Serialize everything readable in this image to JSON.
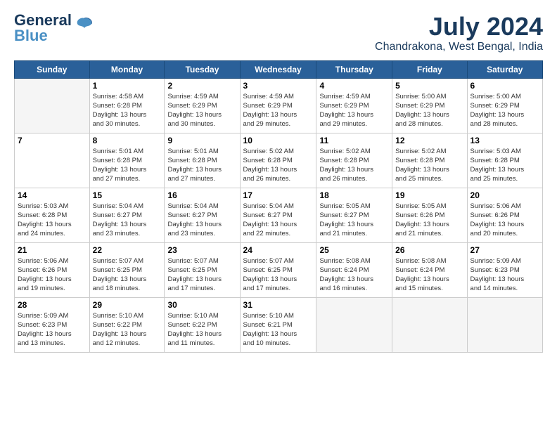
{
  "logo": {
    "line1": "General",
    "line2": "Blue"
  },
  "title": "July 2024",
  "subtitle": "Chandrakona, West Bengal, India",
  "days_of_week": [
    "Sunday",
    "Monday",
    "Tuesday",
    "Wednesday",
    "Thursday",
    "Friday",
    "Saturday"
  ],
  "weeks": [
    [
      {
        "day": "",
        "info": ""
      },
      {
        "day": "1",
        "info": "Sunrise: 4:58 AM\nSunset: 6:28 PM\nDaylight: 13 hours\nand 30 minutes."
      },
      {
        "day": "2",
        "info": "Sunrise: 4:59 AM\nSunset: 6:29 PM\nDaylight: 13 hours\nand 30 minutes."
      },
      {
        "day": "3",
        "info": "Sunrise: 4:59 AM\nSunset: 6:29 PM\nDaylight: 13 hours\nand 29 minutes."
      },
      {
        "day": "4",
        "info": "Sunrise: 4:59 AM\nSunset: 6:29 PM\nDaylight: 13 hours\nand 29 minutes."
      },
      {
        "day": "5",
        "info": "Sunrise: 5:00 AM\nSunset: 6:29 PM\nDaylight: 13 hours\nand 28 minutes."
      },
      {
        "day": "6",
        "info": "Sunrise: 5:00 AM\nSunset: 6:29 PM\nDaylight: 13 hours\nand 28 minutes."
      }
    ],
    [
      {
        "day": "7",
        "info": ""
      },
      {
        "day": "8",
        "info": "Sunrise: 5:01 AM\nSunset: 6:28 PM\nDaylight: 13 hours\nand 27 minutes."
      },
      {
        "day": "9",
        "info": "Sunrise: 5:01 AM\nSunset: 6:28 PM\nDaylight: 13 hours\nand 27 minutes."
      },
      {
        "day": "10",
        "info": "Sunrise: 5:02 AM\nSunset: 6:28 PM\nDaylight: 13 hours\nand 26 minutes."
      },
      {
        "day": "11",
        "info": "Sunrise: 5:02 AM\nSunset: 6:28 PM\nDaylight: 13 hours\nand 26 minutes."
      },
      {
        "day": "12",
        "info": "Sunrise: 5:02 AM\nSunset: 6:28 PM\nDaylight: 13 hours\nand 25 minutes."
      },
      {
        "day": "13",
        "info": "Sunrise: 5:03 AM\nSunset: 6:28 PM\nDaylight: 13 hours\nand 25 minutes."
      }
    ],
    [
      {
        "day": "14",
        "info": "Sunrise: 5:03 AM\nSunset: 6:28 PM\nDaylight: 13 hours\nand 24 minutes."
      },
      {
        "day": "15",
        "info": "Sunrise: 5:04 AM\nSunset: 6:27 PM\nDaylight: 13 hours\nand 23 minutes."
      },
      {
        "day": "16",
        "info": "Sunrise: 5:04 AM\nSunset: 6:27 PM\nDaylight: 13 hours\nand 23 minutes."
      },
      {
        "day": "17",
        "info": "Sunrise: 5:04 AM\nSunset: 6:27 PM\nDaylight: 13 hours\nand 22 minutes."
      },
      {
        "day": "18",
        "info": "Sunrise: 5:05 AM\nSunset: 6:27 PM\nDaylight: 13 hours\nand 21 minutes."
      },
      {
        "day": "19",
        "info": "Sunrise: 5:05 AM\nSunset: 6:26 PM\nDaylight: 13 hours\nand 21 minutes."
      },
      {
        "day": "20",
        "info": "Sunrise: 5:06 AM\nSunset: 6:26 PM\nDaylight: 13 hours\nand 20 minutes."
      }
    ],
    [
      {
        "day": "21",
        "info": "Sunrise: 5:06 AM\nSunset: 6:26 PM\nDaylight: 13 hours\nand 19 minutes."
      },
      {
        "day": "22",
        "info": "Sunrise: 5:07 AM\nSunset: 6:25 PM\nDaylight: 13 hours\nand 18 minutes."
      },
      {
        "day": "23",
        "info": "Sunrise: 5:07 AM\nSunset: 6:25 PM\nDaylight: 13 hours\nand 17 minutes."
      },
      {
        "day": "24",
        "info": "Sunrise: 5:07 AM\nSunset: 6:25 PM\nDaylight: 13 hours\nand 17 minutes."
      },
      {
        "day": "25",
        "info": "Sunrise: 5:08 AM\nSunset: 6:24 PM\nDaylight: 13 hours\nand 16 minutes."
      },
      {
        "day": "26",
        "info": "Sunrise: 5:08 AM\nSunset: 6:24 PM\nDaylight: 13 hours\nand 15 minutes."
      },
      {
        "day": "27",
        "info": "Sunrise: 5:09 AM\nSunset: 6:23 PM\nDaylight: 13 hours\nand 14 minutes."
      }
    ],
    [
      {
        "day": "28",
        "info": "Sunrise: 5:09 AM\nSunset: 6:23 PM\nDaylight: 13 hours\nand 13 minutes."
      },
      {
        "day": "29",
        "info": "Sunrise: 5:10 AM\nSunset: 6:22 PM\nDaylight: 13 hours\nand 12 minutes."
      },
      {
        "day": "30",
        "info": "Sunrise: 5:10 AM\nSunset: 6:22 PM\nDaylight: 13 hours\nand 11 minutes."
      },
      {
        "day": "31",
        "info": "Sunrise: 5:10 AM\nSunset: 6:21 PM\nDaylight: 13 hours\nand 10 minutes."
      },
      {
        "day": "",
        "info": ""
      },
      {
        "day": "",
        "info": ""
      },
      {
        "day": "",
        "info": ""
      }
    ]
  ]
}
